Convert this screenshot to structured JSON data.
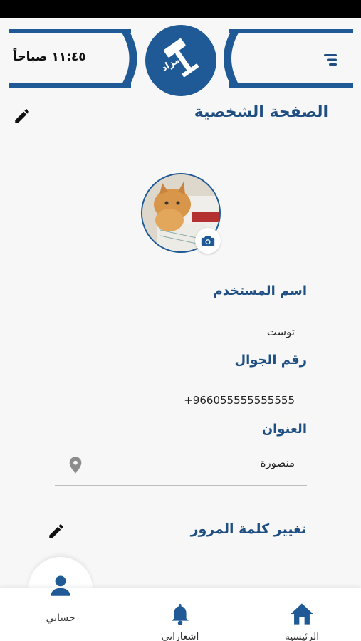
{
  "header": {
    "time": "١١:٤٥ صباحاً",
    "logo_text": "مزاد"
  },
  "page": {
    "title": "الصفحة الشخصية"
  },
  "fields": {
    "username": {
      "label": "اسم المستخدم",
      "value": "توست"
    },
    "phone": {
      "label": "رقم الجوال",
      "value": "+966055555555555"
    },
    "address": {
      "label": "العنوان",
      "value": "منصورة"
    }
  },
  "password": {
    "label": "تغيير كلمة المرور"
  },
  "nav": {
    "account": "حسابي",
    "notifications": "اشعاراتي",
    "home": "الرئيسية"
  },
  "colors": {
    "primary": "#1f5a96",
    "title": "#1f4f82"
  },
  "icons": [
    "menu-icon",
    "gavel-logo",
    "edit-icon",
    "camera-icon",
    "location-pin-icon",
    "user-icon",
    "bell-icon",
    "home-icon"
  ]
}
